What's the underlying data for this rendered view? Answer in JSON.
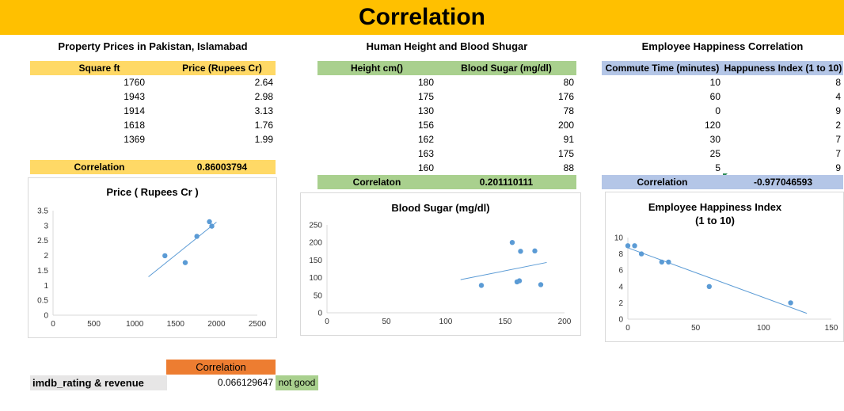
{
  "page_title": "Correlation",
  "colors": {
    "banner": "#ffc000",
    "prop_header": "#ffd966",
    "height_header": "#a9d08e",
    "emp_header": "#b4c6e7",
    "corr_orange": "#ed7d31",
    "not_good": "#a9d08e",
    "label_gray": "#e7e6e6",
    "series": "#5b9bd5"
  },
  "property": {
    "title": "Property Prices in Pakistan, Islamabad",
    "col1": "Square ft",
    "col2": "Price (Rupees Cr)",
    "rows": [
      [
        "1760",
        "2.64"
      ],
      [
        "1943",
        "2.98"
      ],
      [
        "1914",
        "3.13"
      ],
      [
        "1618",
        "1.76"
      ],
      [
        "1369",
        "1.99"
      ]
    ],
    "corr_label": "Correlation",
    "corr_value": "0.86003794"
  },
  "height": {
    "title": "Human Height and Blood Shugar",
    "col1": "Height cm()",
    "col2": "Blood Sugar (mg/dl)",
    "rows": [
      [
        "180",
        "80"
      ],
      [
        "175",
        "176"
      ],
      [
        "130",
        "78"
      ],
      [
        "156",
        "200"
      ],
      [
        "162",
        "91"
      ],
      [
        "163",
        "175"
      ],
      [
        "160",
        "88"
      ]
    ],
    "corr_label": "Correlaton",
    "corr_value": "0.201110111"
  },
  "employee": {
    "title": "Employee Happiness Correlation",
    "col1": "Commute Time (minutes)",
    "col2": "Happuness Index (1 to 10)",
    "rows": [
      [
        "10",
        "8"
      ],
      [
        "60",
        "4"
      ],
      [
        "0",
        "9"
      ],
      [
        "120",
        "2"
      ],
      [
        "30",
        "7"
      ],
      [
        "25",
        "7"
      ],
      [
        "5",
        "9"
      ]
    ],
    "corr_label": "Correlation",
    "corr_value": "-0.977046593"
  },
  "bottom": {
    "corr_header": "Correlation",
    "label": "imdb_rating & revenue",
    "value": "0.066129647",
    "verdict": "not good"
  },
  "chart_data": [
    {
      "type": "scatter",
      "title": "Price ( Rupees Cr )",
      "x": [
        1760,
        1943,
        1914,
        1618,
        1369
      ],
      "y": [
        2.64,
        2.98,
        3.13,
        1.76,
        1.99
      ],
      "xlim": [
        0,
        2500
      ],
      "ylim": [
        0,
        3.5
      ],
      "xticks": [
        "0",
        "500",
        "1000",
        "1500",
        "2000",
        "2500"
      ],
      "yticks": [
        "0",
        "0.5",
        "1",
        "1.5",
        "2",
        "2.5",
        "3",
        "3.5"
      ],
      "trendline": true,
      "grid": false
    },
    {
      "type": "scatter",
      "title": "Blood Sugar (mg/dl)",
      "x": [
        180,
        175,
        130,
        156,
        162,
        163,
        160
      ],
      "y": [
        80,
        176,
        78,
        200,
        91,
        175,
        88
      ],
      "xlim": [
        0,
        200
      ],
      "ylim": [
        0,
        250
      ],
      "xticks": [
        "0",
        "50",
        "100",
        "150",
        "200"
      ],
      "yticks": [
        "0",
        "50",
        "100",
        "150",
        "200",
        "250"
      ],
      "trendline": true,
      "grid": false
    },
    {
      "type": "scatter",
      "title": "Employee Happiness Index (1 to 10)",
      "title_lines": [
        "Employee Happiness Index",
        "(1 to 10)"
      ],
      "x": [
        10,
        60,
        0,
        120,
        30,
        25,
        5
      ],
      "y": [
        8,
        4,
        9,
        2,
        7,
        7,
        9
      ],
      "xlim": [
        0,
        150
      ],
      "ylim": [
        0,
        10
      ],
      "xticks": [
        "0",
        "50",
        "100",
        "150"
      ],
      "yticks": [
        "0",
        "2",
        "4",
        "6",
        "8",
        "10"
      ],
      "trendline": true,
      "grid": false
    }
  ]
}
